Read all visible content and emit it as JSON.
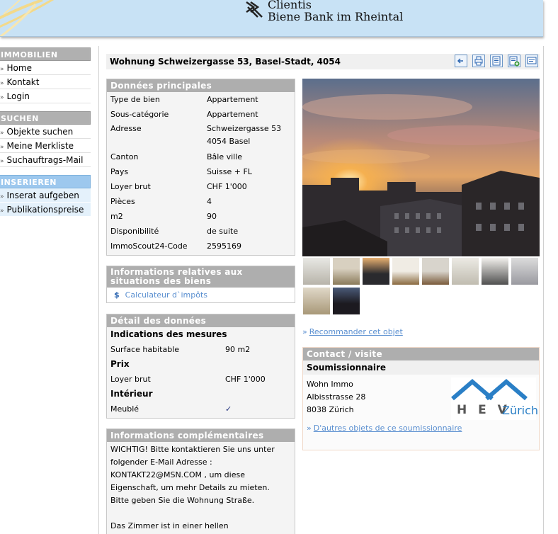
{
  "header": {
    "brand_name": "Clientis",
    "brand_sub": "Biene Bank im Rheintal"
  },
  "sidebar": {
    "sections": [
      {
        "title": "IMMOBILIEN",
        "items": [
          "Home",
          "Kontakt",
          "Login"
        ]
      },
      {
        "title": "SUCHEN",
        "items": [
          "Objekte suchen",
          "Meine Merkliste",
          "Suchauftrags-Mail"
        ]
      },
      {
        "title": "INSERIEREN",
        "items": [
          "Inserat aufgeben",
          "Publikationspreise"
        ]
      }
    ]
  },
  "listing": {
    "title": "Wohnung Schweizergasse 53, Basel-Stadt, 4054",
    "tools": [
      "back-icon",
      "print-icon",
      "list-icon",
      "add-to-list-icon",
      "message-icon"
    ]
  },
  "main_data": {
    "heading": "Données principales",
    "rows": [
      {
        "k": "Type de bien",
        "v": "Appartement"
      },
      {
        "k": "Sous-catégorie",
        "v": "Appartement"
      },
      {
        "k": "Adresse",
        "v": "Schweizergasse 53",
        "v2": "4054 Basel"
      },
      {
        "k": "Canton",
        "v": "Bâle ville"
      },
      {
        "k": "Pays",
        "v": "Suisse + FL"
      },
      {
        "k": "Loyer brut",
        "v": "CHF 1'000"
      },
      {
        "k": "Pièces",
        "v": "4"
      },
      {
        "k": "m2",
        "v": "90"
      },
      {
        "k": "Disponibilité",
        "v": "de suite"
      },
      {
        "k": "ImmoScout24-Code",
        "v": "2595169"
      }
    ]
  },
  "situation": {
    "heading": "Informations relatives aux situations des biens",
    "link": "Calculateur d`impôts",
    "icon": "dollar-icon"
  },
  "details": {
    "heading": "Détail des données",
    "measures_heading": "Indications des mesures",
    "surface_label": "Surface habitable",
    "surface_value": "90 m2",
    "price_heading": "Prix",
    "rent_label": "Loyer brut",
    "rent_value": "CHF 1'000",
    "interior_heading": "Intérieur",
    "furnished_label": "Meublé",
    "furnished_value": "✓"
  },
  "extra": {
    "heading": "Informations complémentaires",
    "lines": [
      "WICHTIG! Bitte kontaktieren Sie uns unter",
      "folgender E-Mail Adresse :",
      "KONTAKT22@MSN.COM , um diese",
      "Eigenschaft, um mehr Details zu mieten.",
      "Bitte geben Sie die Wohnung Straße.",
      "",
      "Das Zimmer ist in einer hellen"
    ]
  },
  "recommend": {
    "link": "Recommander cet objet"
  },
  "contact": {
    "heading": "Contact / visite",
    "sub": "Soumissionnaire",
    "name": "Wohn Immo",
    "street": "Albisstrasse 28",
    "city": "8038 Zürich",
    "logo_text": "H E V",
    "logo_city": "Zürich",
    "more_link": "D'autres objets de ce soumissionnaire"
  },
  "colors": {
    "header_bg": "#c8e2f5",
    "box_head": "#aeaeae",
    "link": "#5a8fd0",
    "logo_blue": "#2a7fc6"
  }
}
